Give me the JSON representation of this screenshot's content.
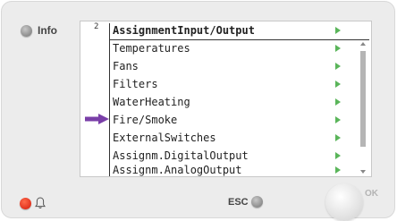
{
  "device": {
    "info_label": "Info",
    "esc_label": "ESC",
    "ok_label": "OK",
    "alarm_color": "#e0331f",
    "ok_icon": "ok-button",
    "bell_icon": "bell-icon"
  },
  "screen": {
    "level": "2",
    "title": "AssignmentInput/Output",
    "selected_index": 4,
    "items": [
      {
        "label": "Temperatures"
      },
      {
        "label": "Fans"
      },
      {
        "label": "Filters"
      },
      {
        "label": "WaterHeating"
      },
      {
        "label": "Fire/Smoke"
      },
      {
        "label": "ExternalSwitches"
      },
      {
        "label": "Assignm.DigitalOutput"
      },
      {
        "label": "Assignm.AnalogOutput"
      }
    ],
    "chevron_color": "#5ab55a",
    "selection_arrow_color": "#7a3fa8"
  }
}
